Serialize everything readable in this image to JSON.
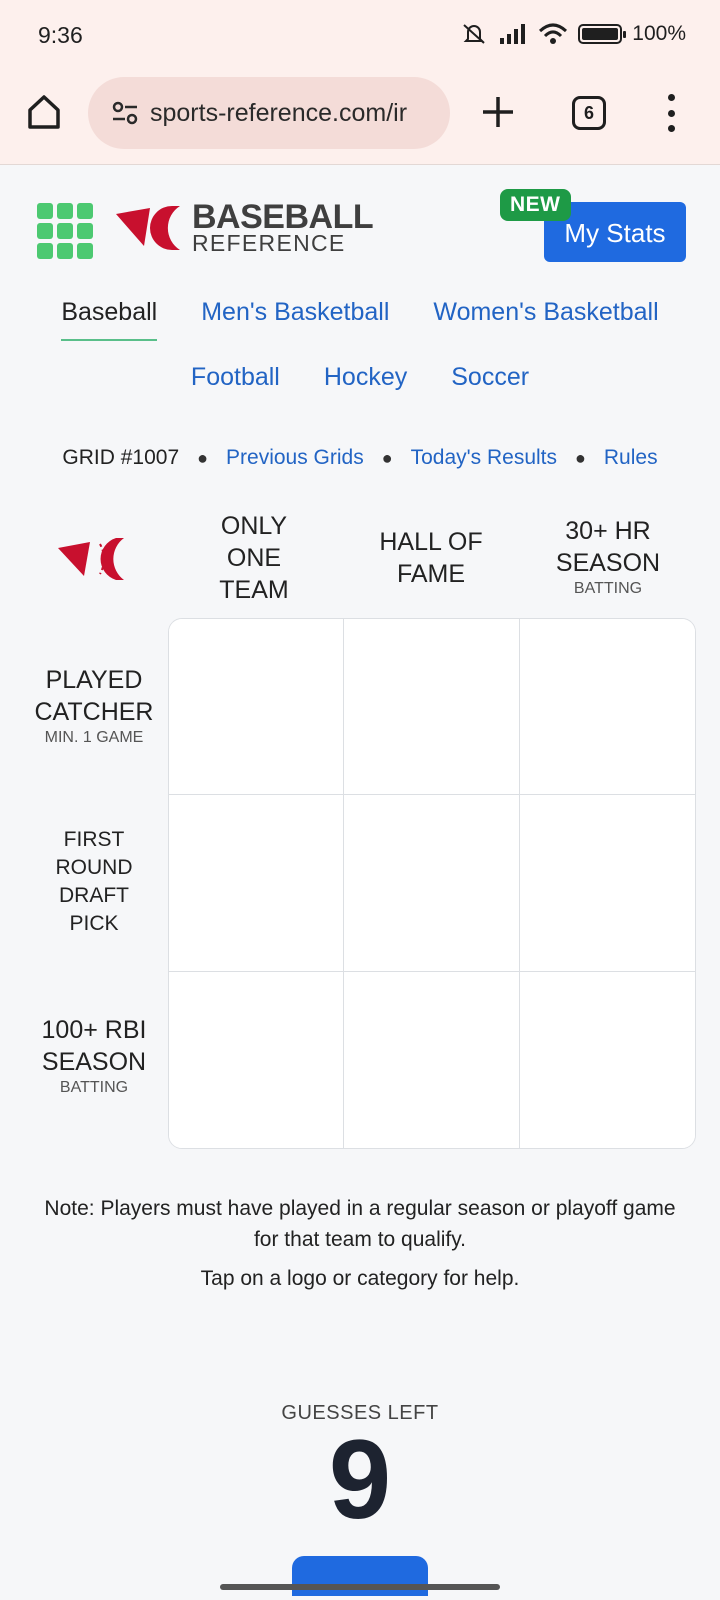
{
  "status": {
    "time": "9:36",
    "battery": "100%"
  },
  "browser": {
    "url": "sports-reference.com/ir",
    "tab_count": "6"
  },
  "header": {
    "logo_line1": "BASEBALL",
    "logo_line2": "REFERENCE",
    "new_badge": "NEW",
    "mystats_label": "My Stats"
  },
  "sports_nav": {
    "row1": [
      "Baseball",
      "Men's Basketball",
      "Women's Basketball"
    ],
    "row2": [
      "Football",
      "Hockey",
      "Soccer"
    ]
  },
  "grid_info": {
    "grid_number": "GRID #1007",
    "links": [
      "Previous Grids",
      "Today's Results",
      "Rules"
    ]
  },
  "columns": [
    {
      "title_lines": [
        "ONLY",
        "ONE",
        "TEAM"
      ],
      "sub": ""
    },
    {
      "title_lines": [
        "HALL OF",
        "FAME"
      ],
      "sub": ""
    },
    {
      "title_lines": [
        "30+ HR",
        "SEASON"
      ],
      "sub": "BATTING"
    }
  ],
  "rows": [
    {
      "title_lines": [
        "PLAYED",
        "CATCHER"
      ],
      "sub": "MIN. 1 GAME"
    },
    {
      "title_lines": [
        "FIRST",
        "ROUND",
        "DRAFT",
        "PICK"
      ],
      "sub": ""
    },
    {
      "title_lines": [
        "100+ RBI",
        "SEASON"
      ],
      "sub": "BATTING"
    }
  ],
  "note": "Note: Players must have played in a regular season or playoff game for that team to qualify.",
  "help_text": "Tap on a logo or category for help.",
  "guesses": {
    "label": "GUESSES LEFT",
    "count": "9"
  },
  "colors": {
    "accent_blue": "#1f6ae0",
    "link_blue": "#2264c4",
    "brand_red": "#c8102e",
    "apps_green": "#4cc971",
    "new_green": "#1e9a46"
  },
  "icons": [
    "home-icon",
    "site-info-icon",
    "new-tab-plus-icon",
    "tab-switcher-icon",
    "more-menu-icon",
    "apps-grid-icon",
    "baseball-reference-logo-icon"
  ]
}
